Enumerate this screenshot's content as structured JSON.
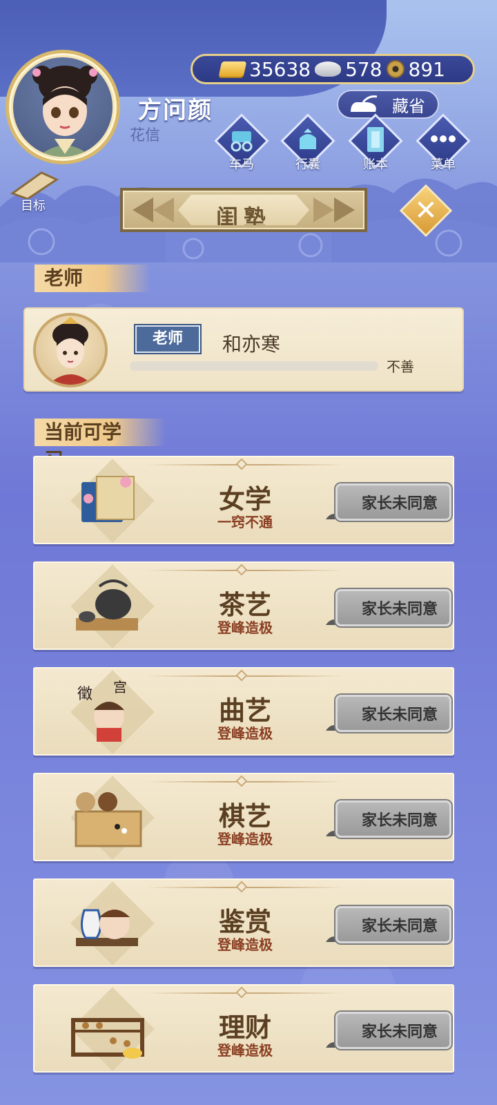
{
  "header": {
    "player_name": "方问颜",
    "player_title": "花信",
    "currency": {
      "gold": "35638",
      "silver": "578",
      "coins": "891"
    },
    "store_label": "藏省",
    "menu": [
      {
        "label": "车马",
        "icon": "carriage-icon"
      },
      {
        "label": "行囊",
        "icon": "bag-icon"
      },
      {
        "label": "账本",
        "icon": "ledger-icon"
      },
      {
        "label": "菜单",
        "icon": "more-icon"
      }
    ],
    "goal_label": "目标"
  },
  "page": {
    "title": "闺塾"
  },
  "teacher_section": {
    "label": "老师",
    "tag": "老师",
    "name": "和亦寒",
    "affinity_text": "不善",
    "affinity_fill": 0
  },
  "courses_section": {
    "label": "当前可学习",
    "courses": [
      {
        "name": "女学",
        "level": "一窍不通",
        "button": "家长未同意",
        "icon": "book-icon"
      },
      {
        "name": "茶艺",
        "level": "登峰造极",
        "button": "家长未同意",
        "icon": "teapot-icon"
      },
      {
        "name": "曲艺",
        "level": "登峰造极",
        "button": "家长未同意",
        "icon": "music-icon"
      },
      {
        "name": "棋艺",
        "level": "登峰造极",
        "button": "家长未同意",
        "icon": "go-board-icon"
      },
      {
        "name": "鉴赏",
        "level": "登峰造极",
        "button": "家长未同意",
        "icon": "vase-icon"
      },
      {
        "name": "理财",
        "level": "登峰造极",
        "button": "家长未同意",
        "icon": "abacus-icon"
      }
    ]
  },
  "colors": {
    "accent_gold": "#e8d08a",
    "course_name": "#5b3f22",
    "course_level": "#8a3e22",
    "disabled_button": "#a8a8a8"
  }
}
